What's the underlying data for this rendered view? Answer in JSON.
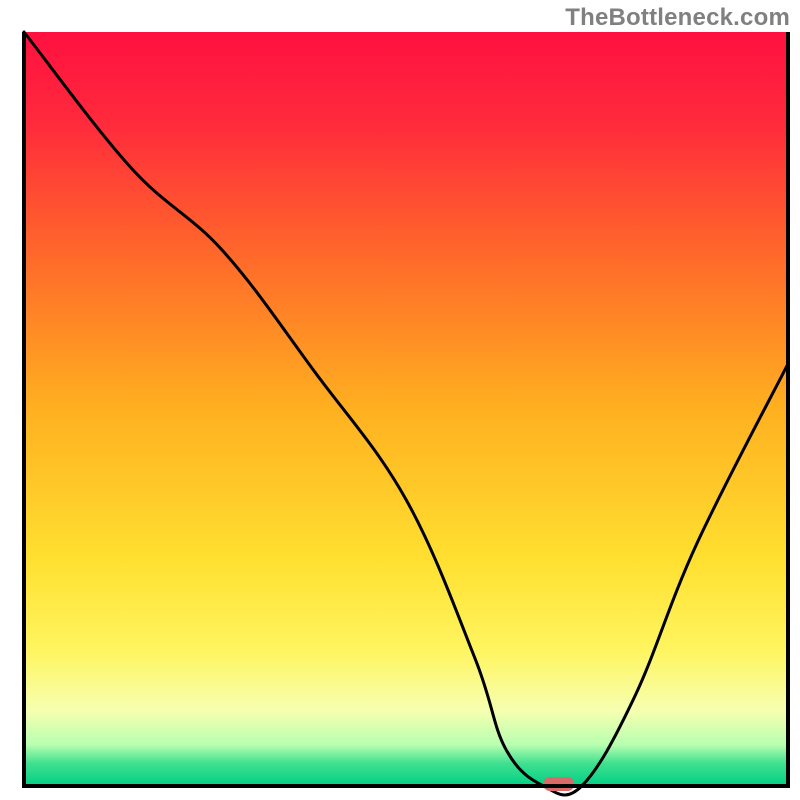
{
  "watermark": "TheBottleneck.com",
  "chart_data": {
    "type": "line",
    "title": "",
    "xlabel": "",
    "ylabel": "",
    "xlim": [
      0,
      100
    ],
    "ylim": [
      0,
      100
    ],
    "x": [
      0,
      14,
      26,
      38,
      50,
      59,
      63,
      68,
      73,
      80,
      88,
      100
    ],
    "values": [
      100,
      82,
      71,
      55,
      38,
      17,
      5,
      0,
      0,
      12,
      32,
      56
    ],
    "curve_note": "V-shaped bottleneck curve; minimum (optimal point) around x≈70 where value≈0; left descent is roughly piecewise-linear with a shoulder near x≈26, right side rises more steeply.",
    "marker": {
      "x": 70,
      "y": 0,
      "color": "#d96a6a",
      "label": "optimal-point"
    },
    "gradient_stops": [
      {
        "offset": 0.0,
        "color": "#ff1040"
      },
      {
        "offset": 0.12,
        "color": "#ff2a3c"
      },
      {
        "offset": 0.3,
        "color": "#ff6a2a"
      },
      {
        "offset": 0.5,
        "color": "#ffb020"
      },
      {
        "offset": 0.7,
        "color": "#ffe030"
      },
      {
        "offset": 0.82,
        "color": "#fff560"
      },
      {
        "offset": 0.9,
        "color": "#f6ffb0"
      },
      {
        "offset": 0.945,
        "color": "#b8ffb0"
      },
      {
        "offset": 0.97,
        "color": "#40e090"
      },
      {
        "offset": 1.0,
        "color": "#00d084"
      }
    ],
    "axis_color": "#000000",
    "curve_color": "#000000"
  }
}
